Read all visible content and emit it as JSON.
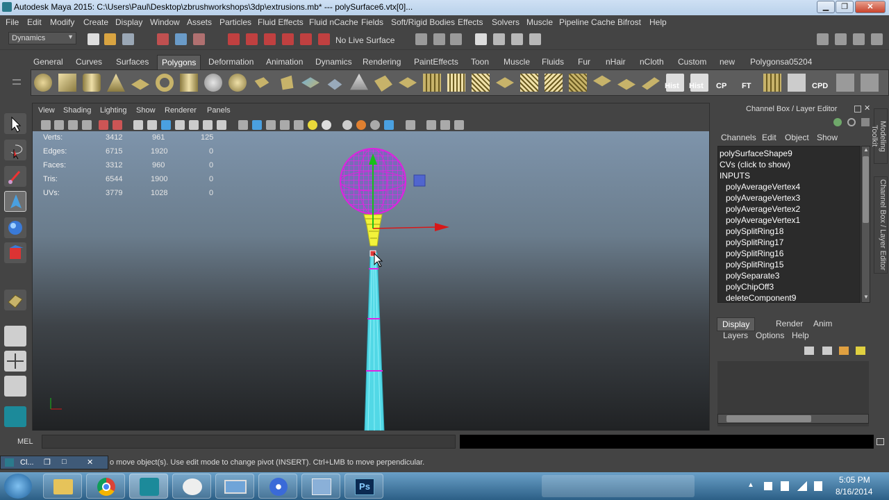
{
  "window": {
    "title": "Autodesk Maya 2015: C:\\Users\\Paul\\Desktop\\zbrushworkshops\\3dp\\extrusions.mb*  ---  polySurface6.vtx[0]...",
    "minimize": "▁",
    "maximize": "❐",
    "close": "✕"
  },
  "menu": [
    "File",
    "Edit",
    "Modify",
    "Create",
    "Display",
    "Window",
    "Assets",
    "Particles",
    "Fluid Effects",
    "Fluid nCache",
    "Fields",
    "Soft/Rigid Bodies",
    "Effects",
    "Solvers",
    "Muscle",
    "Pipeline Cache",
    "Bifrost",
    "Help"
  ],
  "status_line": {
    "menu_set": "Dynamics",
    "live_surface": "No Live Surface"
  },
  "shelf": {
    "tabs": [
      "General",
      "Curves",
      "Surfaces",
      "Polygons",
      "Deformation",
      "Animation",
      "Dynamics",
      "Rendering",
      "PaintEffects",
      "Toon",
      "Muscle",
      "Fluids",
      "Fur",
      "nHair",
      "nCloth",
      "Custom",
      "new",
      "Polygonsa05204"
    ],
    "active_tab": "Polygons",
    "labeled_buttons": [
      "Hist",
      "Hist",
      "CP",
      "FT",
      "CPD"
    ]
  },
  "viewport": {
    "menu": [
      "View",
      "Shading",
      "Lighting",
      "Show",
      "Renderer",
      "Panels"
    ],
    "hud": {
      "labels": [
        "Verts:",
        "Edges:",
        "Faces:",
        "Tris:",
        "UVs:"
      ],
      "col1": [
        "3412",
        "6715",
        "3312",
        "6544",
        "3779"
      ],
      "col2": [
        "961",
        "1920",
        "960",
        "1900",
        "1028"
      ],
      "col3": [
        "125",
        "0",
        "0",
        "0",
        "0"
      ]
    }
  },
  "channel_box": {
    "title": "Channel Box / Layer Editor",
    "menu": [
      "Channels",
      "Edit",
      "Object",
      "Show"
    ],
    "items": [
      "polySurfaceShape9",
      "CVs (click to show)",
      "INPUTS",
      "polyAverageVertex4",
      "polyAverageVertex3",
      "polyAverageVertex2",
      "polyAverageVertex1",
      "polySplitRing18",
      "polySplitRing17",
      "polySplitRing16",
      "polySplitRing15",
      "polySeparate3",
      "polyChipOff3",
      "deleteComponent9"
    ],
    "layer_tabs": [
      "Display",
      "Render",
      "Anim"
    ],
    "active_layer_tab": "Display",
    "layer_menu": [
      "Layers",
      "Options",
      "Help"
    ],
    "side_tabs": [
      "Modeling Toolkit",
      "Channel Box / Layer Editor"
    ]
  },
  "command_line": {
    "label": "MEL"
  },
  "help_line": {
    "text": "o move object(s). Use edit mode to change pivot (INSERT).  Ctrl+LMB to move perpendicular.",
    "minimized_window": "Cl..."
  },
  "taskbar": {
    "time": "5:05 PM",
    "date": "8/16/2014"
  },
  "colors": {
    "wire_magenta": "#e020e0",
    "mesh_cyan": "#52d8e6",
    "selected_yellow": "#f2f23a",
    "manipulator_red": "#d81818",
    "manipulator_green": "#18c018",
    "title_gradient_top": "#cfe0f4"
  }
}
